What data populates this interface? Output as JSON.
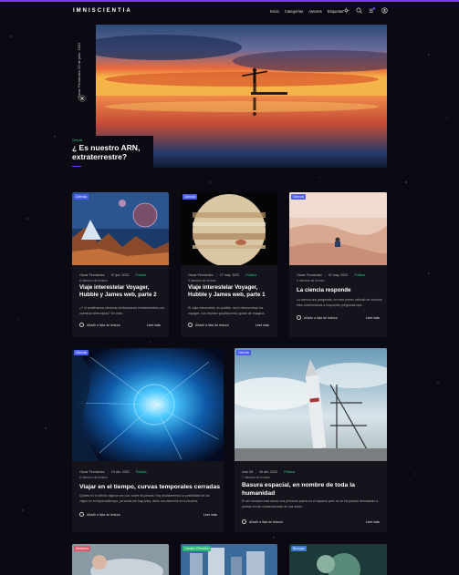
{
  "nav": {
    "logo": "IMNISCIENTIA",
    "menu": [
      "Inicio",
      "Categorías",
      "Autores",
      "Etiquetas"
    ],
    "badge": "1"
  },
  "hero": {
    "date_line1": "Oscar Fernández 20 de",
    "date_line2": "julio, 2022",
    "tag": "Ciencia",
    "title": "¿ Es nuestro ARN, extraterrestre?"
  },
  "cards": [
    {
      "badge": "Ciencia",
      "author": "Oscar Fernández",
      "date": "07 jun. 2022",
      "category": "Pública",
      "read_time": "6 minutos de lectura",
      "title": "Viaje interestelar Voyager, Hubble y James web, parte 2",
      "excerpt": "¿Y si pudiéramos observar civilizaciones extraterrestres con nuestros telescopios? En este...",
      "add": "Añadir a lista de lectura",
      "more": "Leer más"
    },
    {
      "badge": "Ciencia",
      "author": "Oscar Fernández",
      "date": "27 may. 2022",
      "category": "Pública",
      "read_time": "9 minutos de lectura",
      "title": "Viaje interestelar Voyager, Hubble y James web, parte 1",
      "excerpt": "El viaje interestelar, es posible, así lo demuestran los voyager, con impulso gravitacional, gozan de imagina...",
      "add": "Añadir a lista de lectura",
      "more": "Leer más"
    },
    {
      "badge": "Ciencia",
      "author": "Oscar Fernández",
      "date": "02 may. 2022",
      "category": "Pública",
      "read_time": "5 minutos de lectura",
      "title": "La ciencia responde",
      "excerpt": "La ciencia sus preguntas, en este primer artículo de muchos más comenzamos a responder preguntas que...",
      "add": "Añadir a lista de lectura",
      "more": "Leer más"
    },
    {
      "badge": "Ciencia",
      "author": "Oscar Fernández",
      "date": "15 abr. 2022",
      "category": "Pública",
      "read_time": "8 minutos de lectura",
      "title": "Viajar en el tiempo, curvas temporales cerradas",
      "excerpt": "Quizás en tu infinito alguna vez con volver al pasado, hoy analizaremos la posibilidad de los viajes en el espacio/tiempo, ya verás,me hay prisa, dedo con atención en tu lectura.",
      "add": "Añadir a lista de lectura",
      "more": "Leer más"
    },
    {
      "badge": "Ciencia",
      "author": "Ivan Gil",
      "date": "08 abr. 2022",
      "category": "Pública",
      "read_time": "7 minutos de lectura",
      "title": "Basura espacial, en nombre de toda la humanidad",
      "excerpt": "El ser humano está dando sus primeros pasos en el espacio pero no se ha parado demasiado a pensar en las consecuencias de sus actos.",
      "add": "Añadir a lista de lectura",
      "more": "Leer más"
    }
  ],
  "bottom_badges": [
    "Medicina",
    "Cambio Climático",
    "Biología"
  ],
  "colors": {
    "accent": "#7a3df0",
    "category": "#24c98a",
    "badge_ciencia": "#4b5cf0",
    "badge_medicina": "#e0556a",
    "badge_clima": "#2bb673",
    "badge_bio": "#3a7bd5"
  }
}
